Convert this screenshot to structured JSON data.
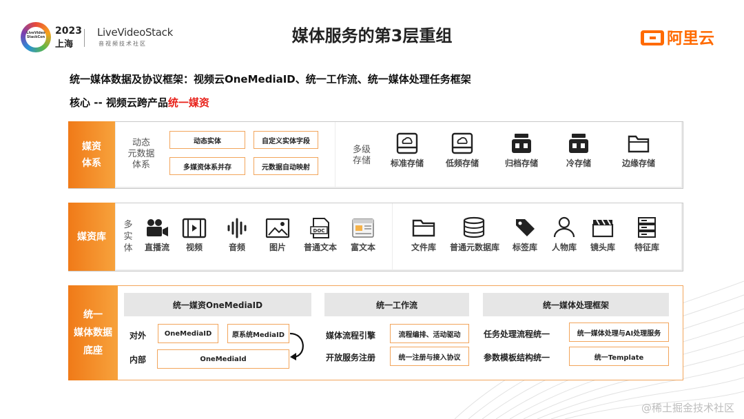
{
  "header": {
    "logo_conf_text": "LiveVideo StackCon",
    "logo_year": "2023",
    "logo_city": "上海",
    "lvs_brand": "LiveVideoStack",
    "lvs_sub": "音视频技术社区",
    "title": "媒体服务的第3层重组",
    "aliyun": "阿里云"
  },
  "subtitle_line1": "统一媒体数据及协议框架：视频云OneMediaID、统一工作流、统一媒体处理任务框架",
  "subtitle_line2_prefix": "核心 -- 视频云跨产品",
  "subtitle_line2_highlight": "统一媒资",
  "row1": {
    "label": "媒资\n体系",
    "meta_label": "动态\n元数据\n体系",
    "boxes": [
      "动态实体",
      "自定义实体字段",
      "多媒资体系并存",
      "元数据自动映射"
    ],
    "storage_label": "多级\n存储",
    "storage_items": [
      {
        "icon": "cloud-drive-icon",
        "label": "标准存储"
      },
      {
        "icon": "cloud-drive-icon",
        "label": "低频存储"
      },
      {
        "icon": "archive-icon",
        "label": "归档存储"
      },
      {
        "icon": "archive-icon",
        "label": "冷存储"
      },
      {
        "icon": "folder-icon",
        "label": "边缘存储"
      }
    ]
  },
  "row2": {
    "label": "媒资库",
    "entity_label": "多\n实\n体",
    "entities": [
      {
        "icon": "video-camera-icon",
        "label": "直播流"
      },
      {
        "icon": "video-play-icon",
        "label": "视频"
      },
      {
        "icon": "audio-wave-icon",
        "label": "音频"
      },
      {
        "icon": "image-icon",
        "label": "图片"
      },
      {
        "icon": "doc-icon",
        "label": "普通文本"
      },
      {
        "icon": "rich-doc-icon",
        "label": "富文本"
      }
    ],
    "libraries": [
      {
        "icon": "folder-icon",
        "label": "文件库"
      },
      {
        "icon": "database-icon",
        "label": "普通元数据库"
      },
      {
        "icon": "tag-icon",
        "label": "标签库"
      },
      {
        "icon": "person-icon",
        "label": "人物库"
      },
      {
        "icon": "clapper-icon",
        "label": "镜头库"
      },
      {
        "icon": "server-icon",
        "label": "特征库"
      }
    ]
  },
  "row3": {
    "label": "统一\n媒体数据\n底座",
    "col1": {
      "header": "统一媒资OneMediaID",
      "external_label": "对外",
      "internal_label": "内部",
      "box_onemediaid": "OneMediaID",
      "box_legacy": "原系统MediaID",
      "box_internal": "OneMediaId"
    },
    "col2": {
      "header": "统一工作流",
      "label1": "媒体流程引擎",
      "box1": "流程编排、活动驱动",
      "label2": "开放服务注册",
      "box2": "统一注册与接入协议"
    },
    "col3": {
      "header": "统一媒体处理框架",
      "label1": "任务处理流程统一",
      "box1": "统一媒体处理与AI处理服务",
      "label2": "参数模板结构统一",
      "box2": "统一Template"
    }
  },
  "watermark": "@稀土掘金技术社区",
  "colors": {
    "accent_orange": "#f07a18",
    "highlight_red": "#e8221b",
    "box_border": "#f2a45a"
  }
}
